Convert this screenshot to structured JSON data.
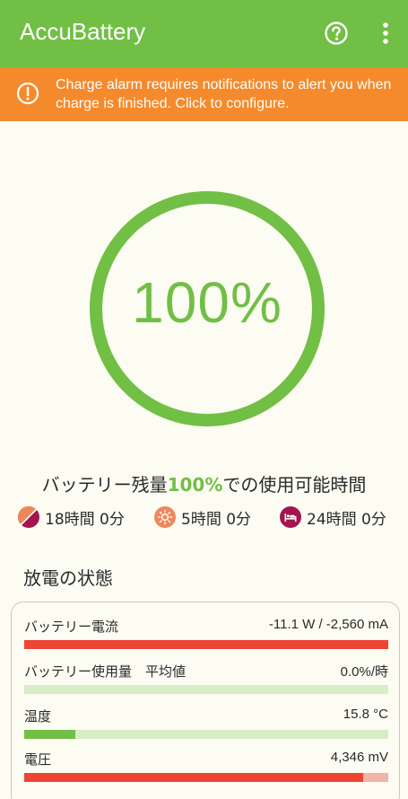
{
  "appbar": {
    "title": "AccuBattery",
    "help_icon": "help-circle-icon",
    "menu_icon": "more-vert-icon"
  },
  "banner": {
    "icon": "alert-circle-icon",
    "text": "Charge alarm requires notifications to alert you when charge is finished. Click to configure."
  },
  "gauge": {
    "value_text": "100%",
    "percent": 100
  },
  "usage": {
    "prefix": "バッテリー残量",
    "percent": "100%",
    "suffix": "での使用可能時間",
    "estimates": [
      {
        "icon": "mixed-use-icon",
        "text": "18時間 0分"
      },
      {
        "icon": "screen-on-icon",
        "text": "5時間 0分"
      },
      {
        "icon": "sleep-icon",
        "text": "24時間 0分"
      }
    ]
  },
  "discharge": {
    "title": "放電の状態",
    "rows": [
      {
        "label": "バッテリー電流",
        "value": "-11.1 W / -2,560 mA",
        "fill": 1.0,
        "color": "#ee4433",
        "track": "#f3b3a8"
      },
      {
        "label": "バッテリー使用量　平均値",
        "value": "0.0%/時",
        "fill": 0.0,
        "color": "#71bf44",
        "track": "#d8ecc6"
      },
      {
        "label": "温度",
        "value": "15.8 °C",
        "fill": 0.14,
        "color": "#71bf44",
        "track": "#d8ecc6"
      },
      {
        "label": "電圧",
        "value": "4,346 mV",
        "fill": 0.93,
        "color": "#ee4433",
        "track": "#f3b3a8"
      }
    ]
  },
  "colors": {
    "accent": "#71bf44",
    "warning": "#f58a2c",
    "danger": "#ee4433",
    "background": "#fcfcf3"
  }
}
